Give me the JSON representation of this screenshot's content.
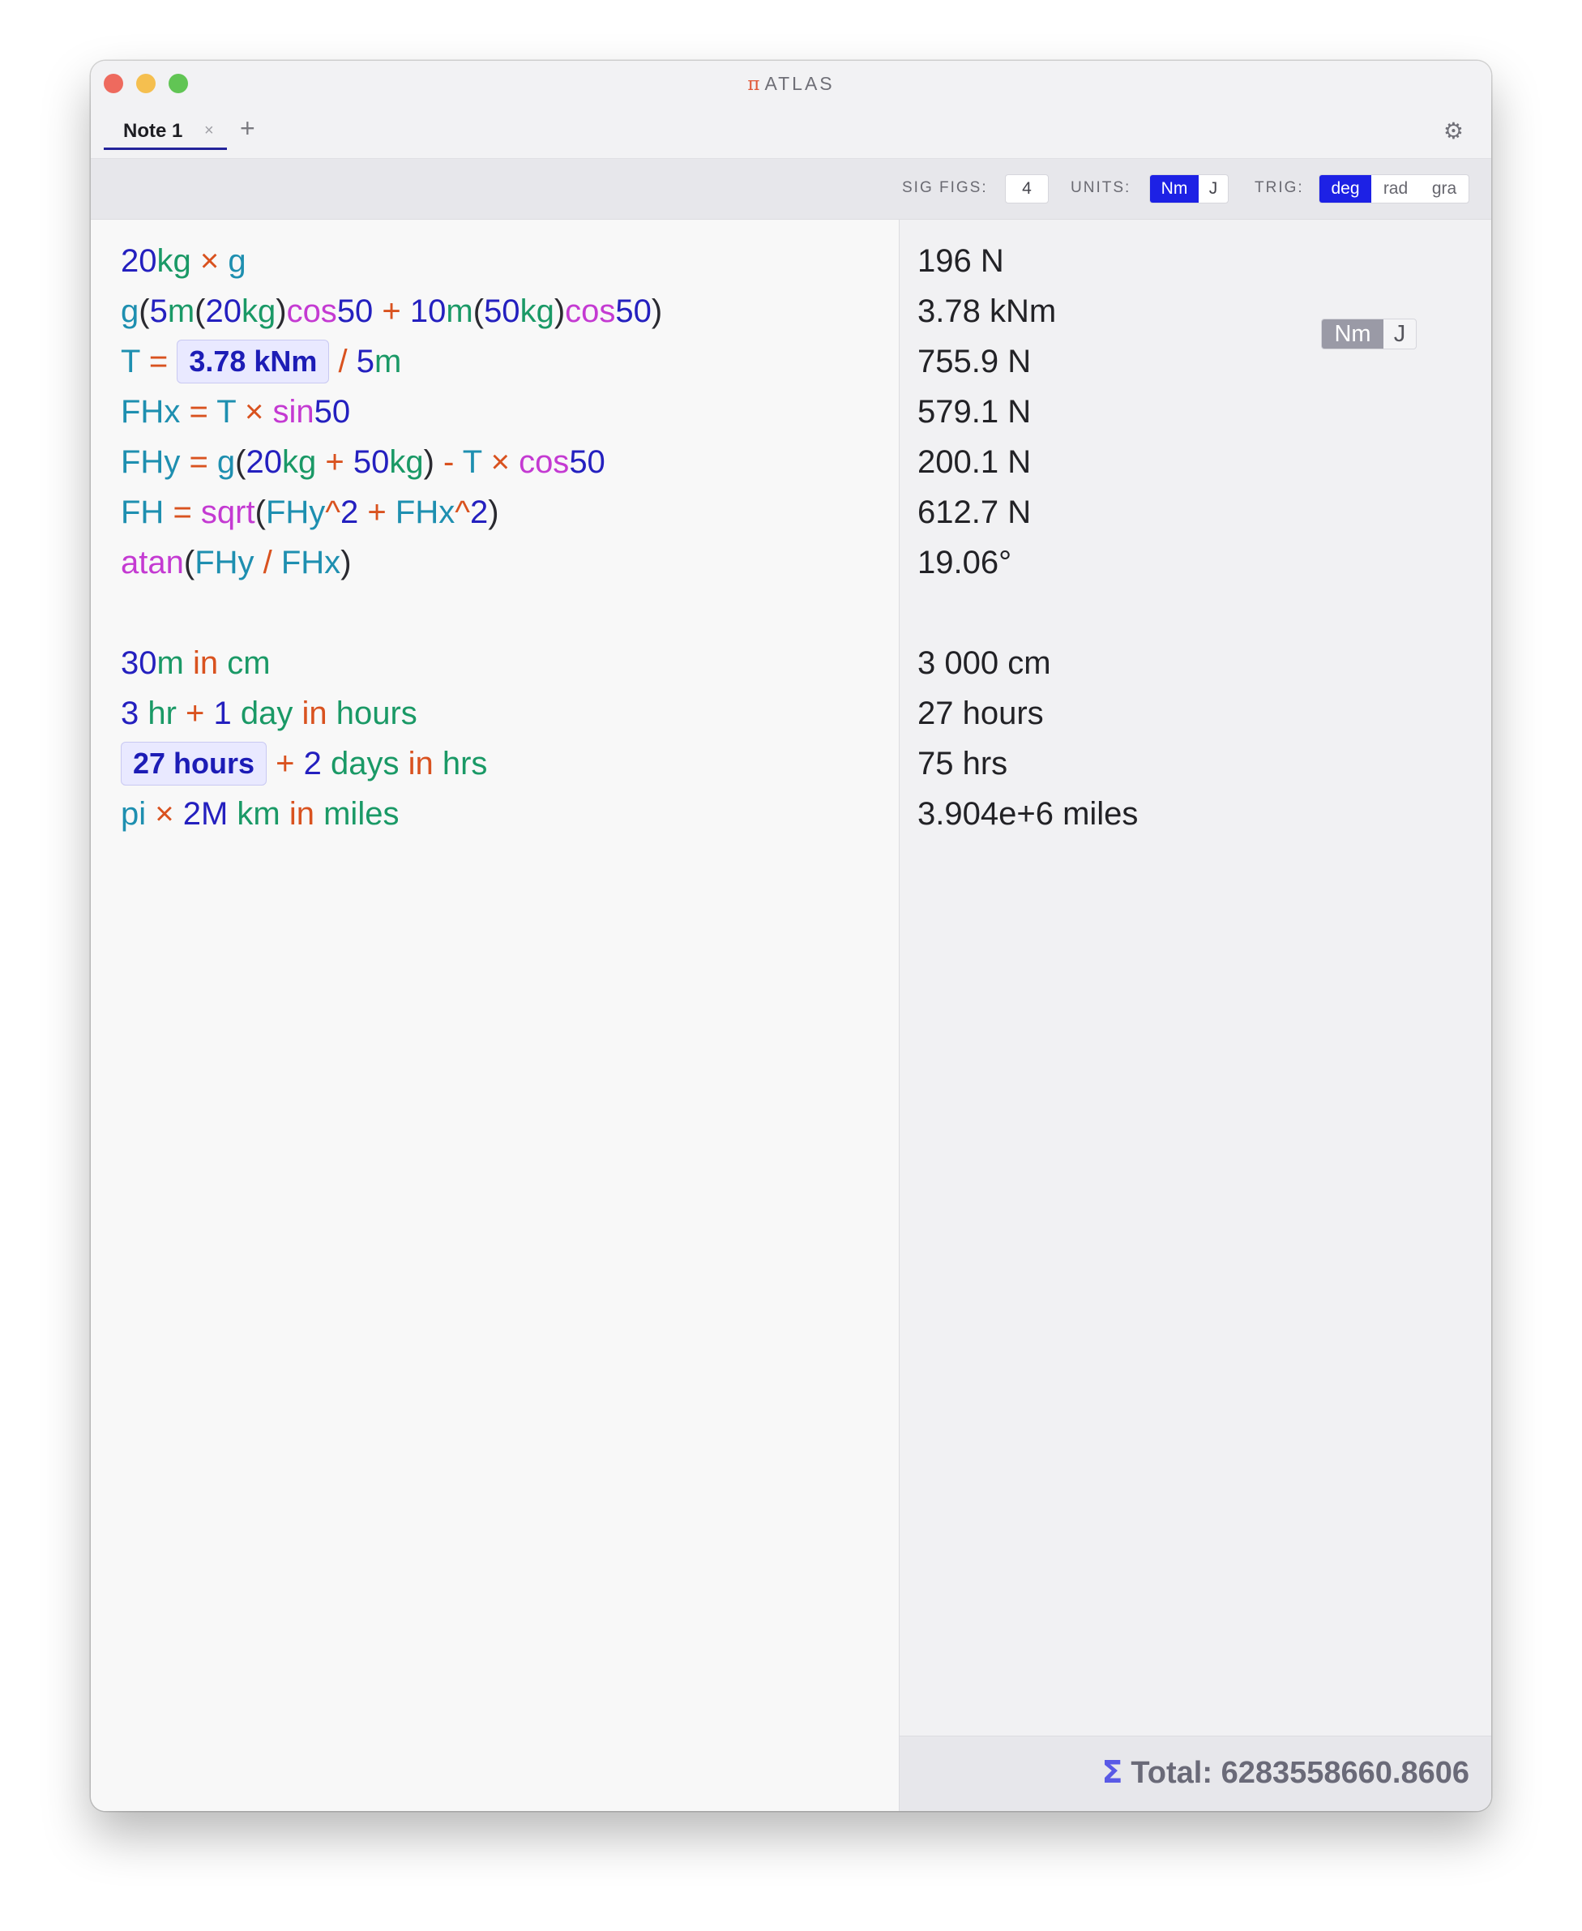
{
  "app": {
    "title": "ATLAS",
    "logo_glyph": "π"
  },
  "tabs": [
    {
      "label": "Note 1",
      "close_glyph": "×"
    }
  ],
  "tab_add_glyph": "+",
  "settings_glyph": "⚙",
  "toolbar": {
    "sig_figs_label": "SIG FIGS:",
    "sig_figs_value": "4",
    "units_label": "UNITS:",
    "units_options": [
      "Nm",
      "J"
    ],
    "units_selected": "Nm",
    "trig_label": "TRIG:",
    "trig_options": [
      "deg",
      "rad",
      "gra"
    ],
    "trig_selected": "deg"
  },
  "lines": [
    [
      [
        "20",
        "n"
      ],
      [
        "kg",
        "u"
      ],
      [
        " × ",
        "o"
      ],
      [
        "g",
        "v"
      ]
    ],
    [
      [
        "g",
        "v"
      ],
      [
        "(",
        "p"
      ],
      [
        "5",
        "n"
      ],
      [
        "m",
        "u"
      ],
      [
        "(",
        "p"
      ],
      [
        "20",
        "n"
      ],
      [
        "kg",
        "u"
      ],
      [
        ")",
        "p"
      ],
      [
        "cos",
        "f"
      ],
      [
        "50",
        "n"
      ],
      [
        " + ",
        "o"
      ],
      [
        "10",
        "n"
      ],
      [
        "m",
        "u"
      ],
      [
        "(",
        "p"
      ],
      [
        "50",
        "n"
      ],
      [
        "kg",
        "u"
      ],
      [
        ")",
        "p"
      ],
      [
        "cos",
        "f"
      ],
      [
        "50",
        "n"
      ],
      [
        ")",
        "p"
      ]
    ],
    [
      [
        "T",
        "v"
      ],
      [
        " = ",
        "o"
      ],
      [
        "3.78 kNm",
        "chip"
      ],
      [
        " / ",
        "o"
      ],
      [
        "5",
        "n"
      ],
      [
        "m",
        "u"
      ]
    ],
    [
      [
        "FHx",
        "v"
      ],
      [
        " = ",
        "o"
      ],
      [
        "T",
        "v"
      ],
      [
        " × ",
        "o"
      ],
      [
        "sin",
        "f"
      ],
      [
        "50",
        "n"
      ]
    ],
    [
      [
        "FHy",
        "v"
      ],
      [
        " = ",
        "o"
      ],
      [
        "g",
        "v"
      ],
      [
        "(",
        "p"
      ],
      [
        "20",
        "n"
      ],
      [
        "kg",
        "u"
      ],
      [
        " + ",
        "o"
      ],
      [
        "50",
        "n"
      ],
      [
        "kg",
        "u"
      ],
      [
        ")",
        "p"
      ],
      [
        " - ",
        "o"
      ],
      [
        "T",
        "v"
      ],
      [
        " × ",
        "o"
      ],
      [
        "cos",
        "f"
      ],
      [
        "50",
        "n"
      ]
    ],
    [
      [
        "FH",
        "v"
      ],
      [
        " = ",
        "o"
      ],
      [
        "sqrt",
        "f"
      ],
      [
        "(",
        "p"
      ],
      [
        "FHy",
        "v"
      ],
      [
        "^",
        "o"
      ],
      [
        "2",
        "n"
      ],
      [
        " + ",
        "o"
      ],
      [
        "FHx",
        "v"
      ],
      [
        "^",
        "o"
      ],
      [
        "2",
        "n"
      ],
      [
        ")",
        "p"
      ]
    ],
    [
      [
        "atan",
        "f"
      ],
      [
        "(",
        "p"
      ],
      [
        "FHy",
        "v"
      ],
      [
        " / ",
        "o"
      ],
      [
        "FHx",
        "v"
      ],
      [
        ")",
        "p"
      ]
    ],
    [],
    [
      [
        "30",
        "n"
      ],
      [
        "m",
        "u"
      ],
      [
        " in ",
        "k"
      ],
      [
        "cm",
        "u"
      ]
    ],
    [
      [
        "3",
        "n"
      ],
      [
        " hr",
        "u"
      ],
      [
        " + ",
        "o"
      ],
      [
        "1",
        "n"
      ],
      [
        " day",
        "u"
      ],
      [
        " in ",
        "k"
      ],
      [
        "hours",
        "u"
      ]
    ],
    [
      [
        "27 hours",
        "chip"
      ],
      [
        " + ",
        "o"
      ],
      [
        "2",
        "n"
      ],
      [
        " days",
        "u"
      ],
      [
        " in ",
        "k"
      ],
      [
        "hrs",
        "u"
      ]
    ],
    [
      [
        "pi",
        "v"
      ],
      [
        " × ",
        "o"
      ],
      [
        "2M",
        "n"
      ],
      [
        " km",
        "u"
      ],
      [
        " in ",
        "k"
      ],
      [
        "miles",
        "u"
      ]
    ]
  ],
  "results": [
    "196 N",
    "3.78 kNm",
    "755.9 N",
    "579.1 N",
    "200.1 N",
    "612.7 N",
    "19.06°",
    "",
    "3 000 cm",
    "27 hours",
    "75 hrs",
    "3.904e+6 miles"
  ],
  "result_unit_toggle": {
    "options": [
      "Nm",
      "J"
    ],
    "selected": "Nm"
  },
  "total": {
    "sigma": "Σ",
    "text": "Total: 6283558660.8606"
  }
}
